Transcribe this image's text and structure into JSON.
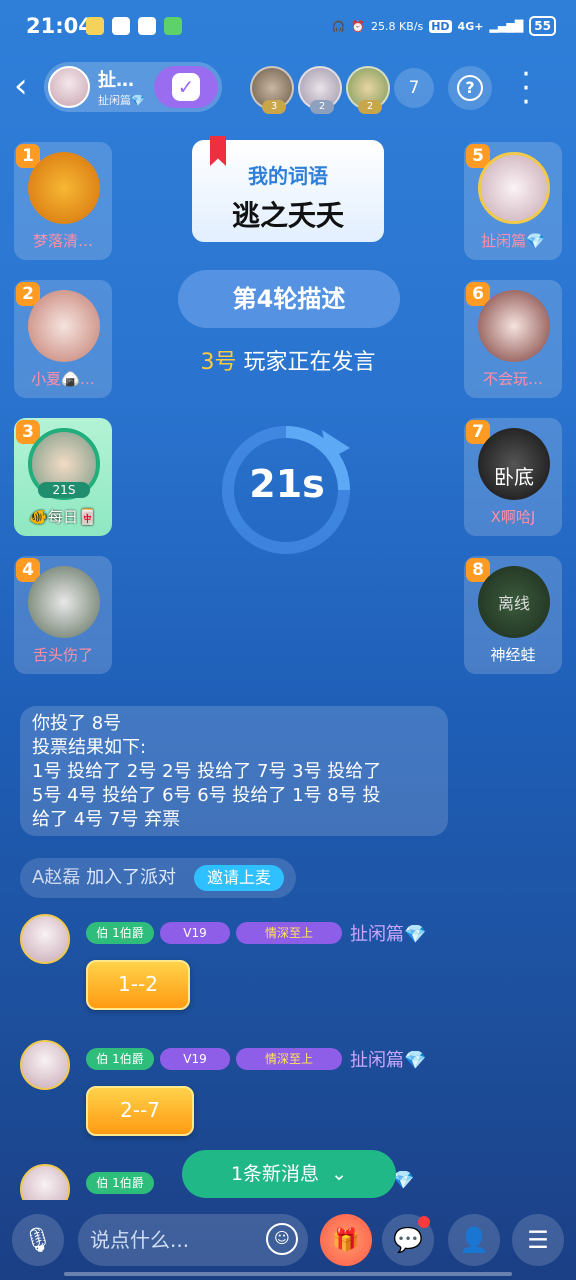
{
  "status": {
    "time": "21:04",
    "net_speed": "25.8 KB/s",
    "hd": "HD",
    "signal": "4G+",
    "battery": "55"
  },
  "room": {
    "name": "扯…",
    "sub": "扯闲篇💎",
    "online_count": "7"
  },
  "top_avatars": [
    {
      "badge": "3"
    },
    {
      "badge": "2"
    },
    {
      "badge": "2"
    }
  ],
  "word_card": {
    "title": "我的词语",
    "word": "逃之夭夭"
  },
  "round": "第4轮描述",
  "speaking": {
    "number": "3号",
    "text": "玩家正在发言"
  },
  "timer": "21s",
  "seats": [
    {
      "num": "1",
      "name": "梦落清…",
      "tone": "pink"
    },
    {
      "num": "2",
      "name": "小夏🍙…",
      "tone": "pink"
    },
    {
      "num": "3",
      "name": "🐠每日🀄",
      "tone": "white",
      "tag": "21S"
    },
    {
      "num": "4",
      "name": "舌头伤了",
      "tone": "pink"
    },
    {
      "num": "5",
      "name": "扯闲篇💎",
      "tone": "pink"
    },
    {
      "num": "6",
      "name": "不会玩…",
      "tone": "pink"
    },
    {
      "num": "7",
      "name": "X啊哈J",
      "tone": "pink",
      "overlay": "卧底"
    },
    {
      "num": "8",
      "name": "神经蛙",
      "tone": "white",
      "overlay": "离线"
    }
  ],
  "system_message": [
    "你投了 8号",
    "投票结果如下:",
    "1号 投给了 2号 2号 投给了 7号 3号 投给了",
    "5号 4号 投给了 6号 6号 投给了 1号 8号 投",
    "给了 4号 7号 弃票"
  ],
  "join": {
    "user": "A赵磊",
    "text": "加入了派对",
    "invite": "邀请上麦"
  },
  "messages": [
    {
      "badge1": "伯 1伯爵",
      "badge2": "V19",
      "badge3": "情深至上",
      "name": "扯闲篇💎",
      "text": "1--2"
    },
    {
      "badge1": "伯 1伯爵",
      "badge2": "V19",
      "badge3": "情深至上",
      "name": "扯闲篇💎",
      "text": "2--7"
    },
    {
      "badge1": "伯 1伯爵",
      "badge2": "",
      "badge3": "",
      "name": "💎",
      "text": ""
    }
  ],
  "new_messages": "1条新消息",
  "input_placeholder": "说点什么..."
}
